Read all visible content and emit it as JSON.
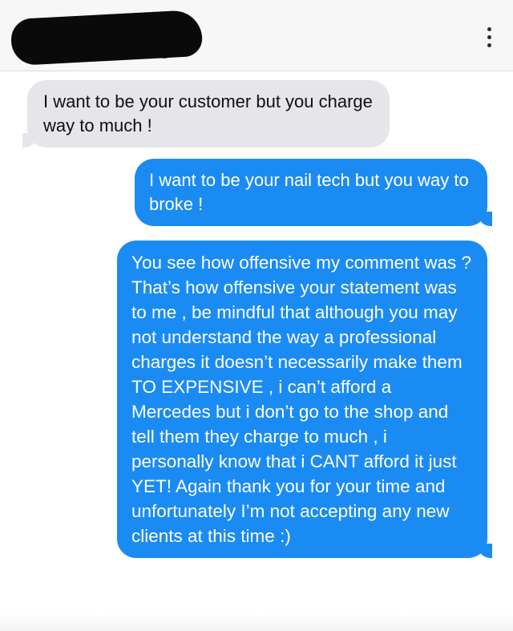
{
  "header": {
    "contact_name": "",
    "more_options_icon": "vertical-dots-icon"
  },
  "messages": [
    {
      "direction": "incoming",
      "text": "I want to be your customer but you charge way to much !"
    },
    {
      "direction": "outgoing",
      "text": "I want to be your nail tech but you way to broke !"
    },
    {
      "direction": "outgoing",
      "text": "You see how offensive my comment was ? That’s how offensive your statement was to me , be mindful that although you may not understand the way a professional charges it doesn’t necessarily make them TO EXPENSIVE , i can’t afford a Mercedes but i don’t go to the shop and tell them they charge to much , i personally know that i CANT afford it just YET! Again thank you for your time and unfortunately I’m not accepting any new clients at this time :)"
    }
  ],
  "colors": {
    "incoming_bubble": "#e5e5ea",
    "outgoing_bubble": "#1b8bf4",
    "header_bg": "#f7f7f7"
  }
}
